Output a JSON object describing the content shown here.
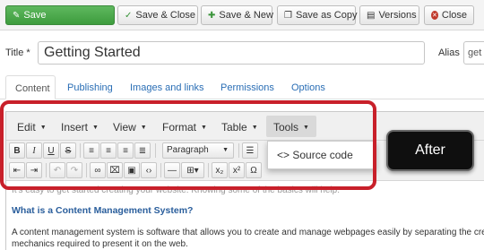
{
  "actions": {
    "save": "Save",
    "save_close": "Save & Close",
    "save_new": "Save & New",
    "save_as_copy": "Save as Copy",
    "versions": "Versions",
    "close": "Close"
  },
  "title_field": {
    "label": "Title *",
    "value": "Getting Started"
  },
  "alias_field": {
    "label": "Alias",
    "value": "get"
  },
  "tabs": [
    {
      "label": "Content"
    },
    {
      "label": "Publishing"
    },
    {
      "label": "Images and links"
    },
    {
      "label": "Permissions"
    },
    {
      "label": "Options"
    }
  ],
  "editor": {
    "menus": [
      {
        "label": "Edit"
      },
      {
        "label": "Insert"
      },
      {
        "label": "View"
      },
      {
        "label": "Format"
      },
      {
        "label": "Table"
      },
      {
        "label": "Tools"
      }
    ],
    "format_select": "Paragraph",
    "tools_dropdown": {
      "item": "Source code",
      "icon": "<>"
    },
    "content": {
      "faded_line": "It's easy to get started creating your website. Knowing some of the basics will help.",
      "heading": "What is a Content Management System?",
      "paragraph_line1": "A content management system is software that allows you to create and manage webpages easily by separating the creation",
      "paragraph_line2": "mechanics required to present it on the web."
    }
  },
  "annotation": {
    "badge": "After",
    "outline_color": "#c8202a"
  },
  "colors": {
    "save_green": "#46a546",
    "link_blue": "#2a6eb5",
    "close_red": "#c0392b"
  }
}
